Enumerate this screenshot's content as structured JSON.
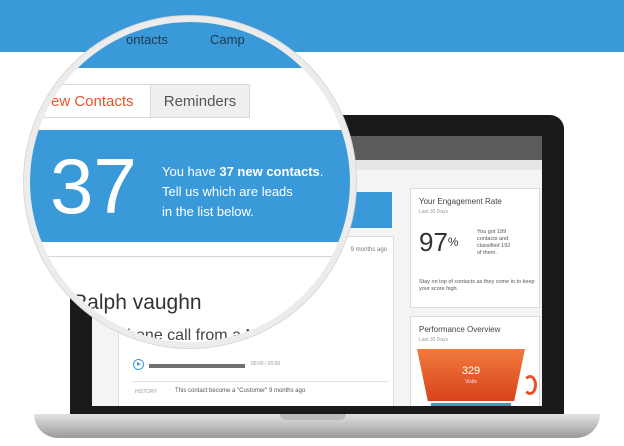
{
  "topnav": {
    "contacts": "ontacts",
    "campaigns": "Camp"
  },
  "tabs": {
    "new_contacts": "ew Contacts",
    "reminders": "Reminders"
  },
  "banner": {
    "count": "37",
    "line1_prefix": "You have ",
    "line1_bold": "37 new contacts",
    "line1_suffix": ".",
    "line2": "Tell us which are leads",
    "line3": "in the list below."
  },
  "contact": {
    "name": "Ralph vaughn",
    "description": "t a phone call from a Ne",
    "time_ago": "9 months ago",
    "audio_time": "00:00 / 00:00",
    "history_label": "HISTORY",
    "history_text": "This contact become a \"Customer\" 9 months ago"
  },
  "engagement": {
    "title": "Your Engagement Rate",
    "subtitle": "Last 30 Days",
    "percent_value": "97",
    "percent_sign": "%",
    "detail_1": "You got 199",
    "detail_2": "contacts and",
    "detail_3": "classified 192",
    "detail_4": "of them.",
    "note": "Stay on top of contacts as they come in to keep your score high."
  },
  "performance": {
    "title": "Performance Overview",
    "subtitle": "Last 30 Days",
    "visits_value": "329",
    "visits_label": "Visits"
  },
  "colors": {
    "brand_blue": "#3a9ad9",
    "accent_orange": "#e8542a"
  }
}
